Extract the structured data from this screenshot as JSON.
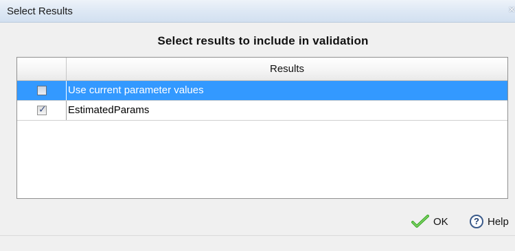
{
  "window": {
    "title": "Select Results",
    "close_glyph": "×"
  },
  "heading": "Select results to include in validation",
  "table": {
    "column_header": "Results",
    "rows": [
      {
        "label": "Use current parameter values",
        "checked": false,
        "selected": true
      },
      {
        "label": "EstimatedParams",
        "checked": true,
        "selected": false
      }
    ]
  },
  "buttons": {
    "ok_label": "OK",
    "ok_icon": "checkmark-icon",
    "help_label": "Help",
    "help_icon": "help-icon",
    "help_glyph": "?"
  },
  "colors": {
    "selection": "#3399ff",
    "ok_icon": "#3fae2c"
  }
}
